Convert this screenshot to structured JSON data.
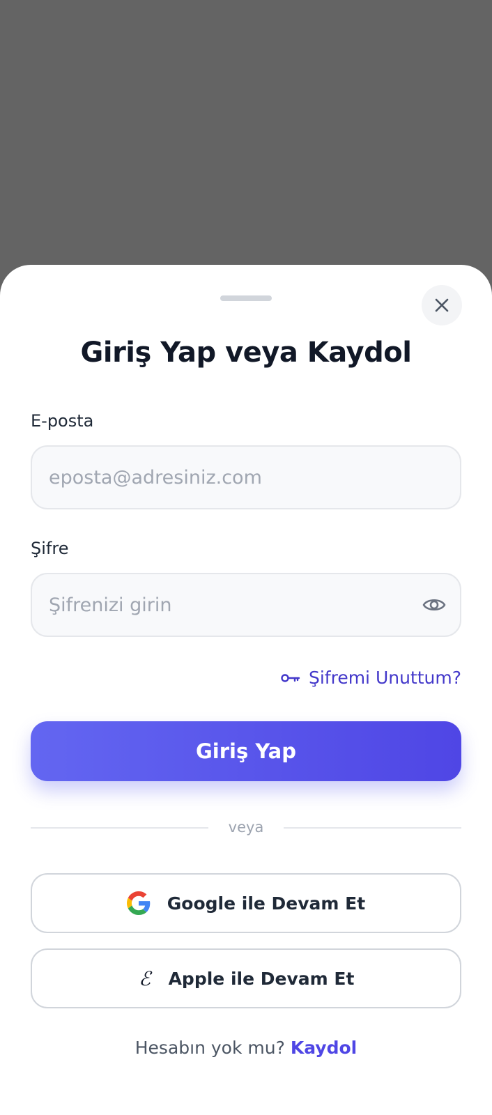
{
  "sheet": {
    "title": "Giriş Yap veya Kaydol"
  },
  "email": {
    "label": "E-posta",
    "placeholder": "eposta@adresiniz.com",
    "value": ""
  },
  "password": {
    "label": "Şifre",
    "placeholder": "Şifrenizi girin",
    "value": ""
  },
  "forgot": {
    "label": "Şifremi Unuttum?"
  },
  "login_button": {
    "label": "Giriş Yap"
  },
  "divider": {
    "text": "veya"
  },
  "social": {
    "google_label": "Google ile Devam Et",
    "apple_label": "Apple ile Devam Et",
    "apple_glyph": "ℰ"
  },
  "footer": {
    "prompt": "Hesabın yok mu?",
    "link": "Kaydol"
  },
  "colors": {
    "backdrop": "#646464",
    "accent": "#4f46e5",
    "accent_light": "#6366f1",
    "link": "#4338ca"
  },
  "icons": {
    "close": "close-icon",
    "eye": "eye-icon",
    "key": "key-icon",
    "google": "google-icon",
    "apple": "apple-icon"
  }
}
